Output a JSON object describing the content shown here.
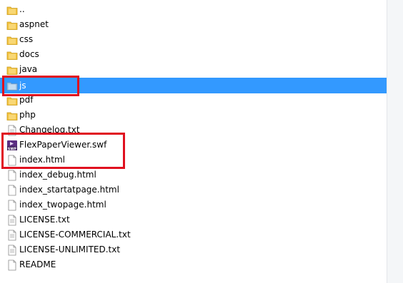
{
  "files": [
    {
      "name": "..",
      "icon": "folder-icon",
      "selected": false
    },
    {
      "name": "aspnet",
      "icon": "folder-icon",
      "selected": false
    },
    {
      "name": "css",
      "icon": "folder-icon",
      "selected": false
    },
    {
      "name": "docs",
      "icon": "folder-icon",
      "selected": false
    },
    {
      "name": "java",
      "icon": "folder-icon",
      "selected": false
    },
    {
      "name": "js",
      "icon": "folder-icon",
      "selected": true
    },
    {
      "name": "pdf",
      "icon": "folder-icon",
      "selected": false
    },
    {
      "name": "php",
      "icon": "folder-icon",
      "selected": false
    },
    {
      "name": "Changelog.txt",
      "icon": "text-file-icon",
      "selected": false
    },
    {
      "name": "FlexPaperViewer.swf",
      "icon": "swf-file-icon",
      "selected": false
    },
    {
      "name": "index.html",
      "icon": "file-icon",
      "selected": false
    },
    {
      "name": "index_debug.html",
      "icon": "file-icon",
      "selected": false
    },
    {
      "name": "index_startatpage.html",
      "icon": "file-icon",
      "selected": false
    },
    {
      "name": "index_twopage.html",
      "icon": "file-icon",
      "selected": false
    },
    {
      "name": "LICENSE.txt",
      "icon": "text-file-icon",
      "selected": false
    },
    {
      "name": "LICENSE-COMMERCIAL.txt",
      "icon": "text-file-icon",
      "selected": false
    },
    {
      "name": "LICENSE-UNLIMITED.txt",
      "icon": "text-file-icon",
      "selected": false
    },
    {
      "name": "README",
      "icon": "file-icon",
      "selected": false
    }
  ],
  "colors": {
    "selection": "#3399ff",
    "annotation": "#e0101f",
    "folder": "#f3c23c"
  }
}
